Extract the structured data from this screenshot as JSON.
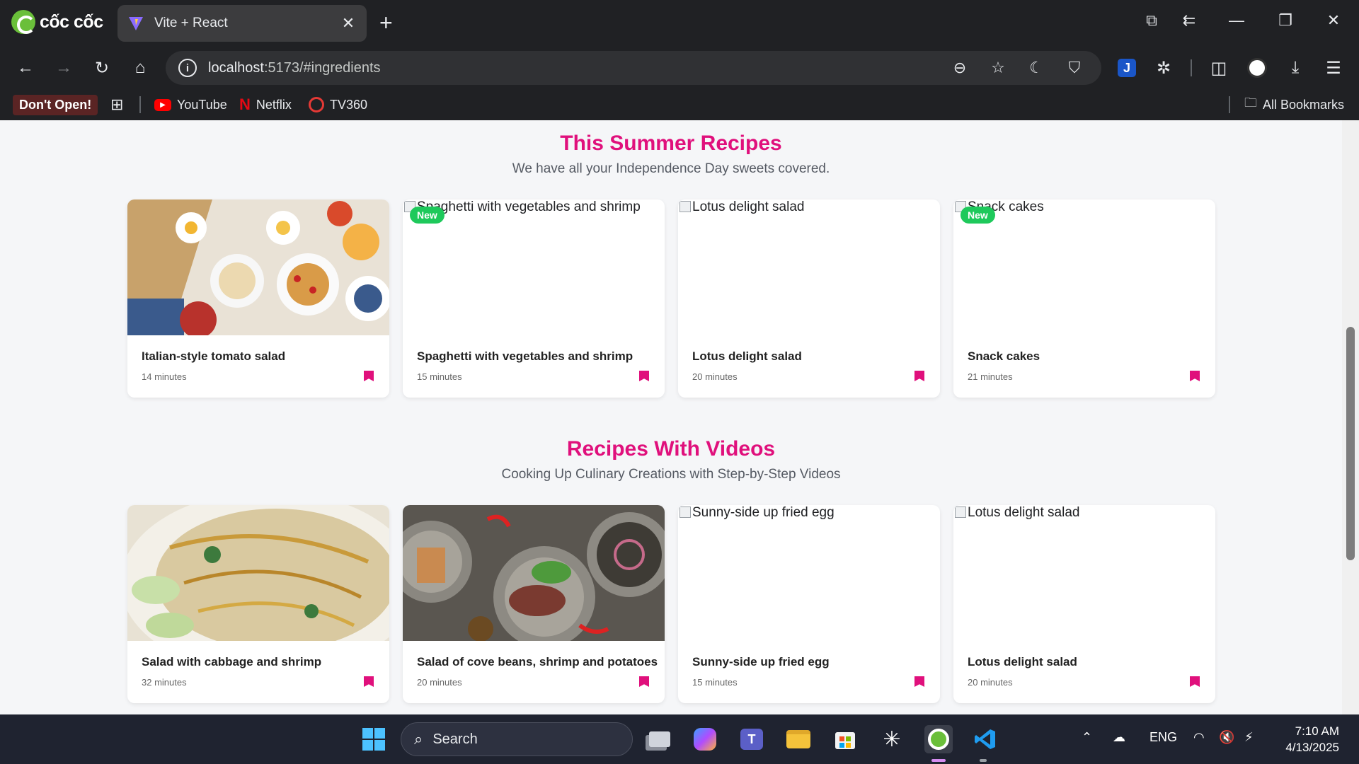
{
  "browser": {
    "brand": "cốc cốc",
    "tab_title": "Vite + React",
    "url_host": "localhost",
    "url_path": ":5173/#ingredients",
    "bookmarks": [
      {
        "label": "Don't Open!"
      },
      {
        "label": "YouTube"
      },
      {
        "label": "Netflix"
      },
      {
        "label": "TV360"
      }
    ],
    "all_bookmarks": "All Bookmarks"
  },
  "summer": {
    "title": "This Summer Recipes",
    "subtitle": "We have all your Independence Day sweets covered.",
    "cards": [
      {
        "name": "Italian-style tomato salad",
        "time": "14 minutes",
        "alt": "",
        "badge": ""
      },
      {
        "name": "Spaghetti with vegetables and shrimp",
        "time": "15 minutes",
        "alt": "Spaghetti with vegetables and shrimp",
        "badge": "New"
      },
      {
        "name": "Lotus delight salad",
        "time": "20 minutes",
        "alt": "Lotus delight salad",
        "badge": ""
      },
      {
        "name": "Snack cakes",
        "time": "21 minutes",
        "alt": "Snack cakes",
        "badge": "New"
      }
    ]
  },
  "videos": {
    "title": "Recipes With Videos",
    "subtitle": "Cooking Up Culinary Creations with Step-by-Step Videos",
    "cards": [
      {
        "name": "Salad with cabbage and shrimp",
        "time": "32 minutes",
        "alt": "",
        "badge": ""
      },
      {
        "name": "Salad of cove beans, shrimp and potatoes",
        "time": "20 minutes",
        "alt": "",
        "badge": ""
      },
      {
        "name": "Sunny-side up fried egg",
        "time": "15 minutes",
        "alt": "Sunny-side up fried egg",
        "badge": ""
      },
      {
        "name": "Lotus delight salad",
        "time": "20 minutes",
        "alt": "Lotus delight salad",
        "badge": ""
      }
    ]
  },
  "taskbar": {
    "search_placeholder": "Search",
    "language": "ENG",
    "time": "7:10 AM",
    "date": "4/13/2025"
  },
  "colors": {
    "accent": "#e0107c",
    "badge": "#1ec95b"
  }
}
